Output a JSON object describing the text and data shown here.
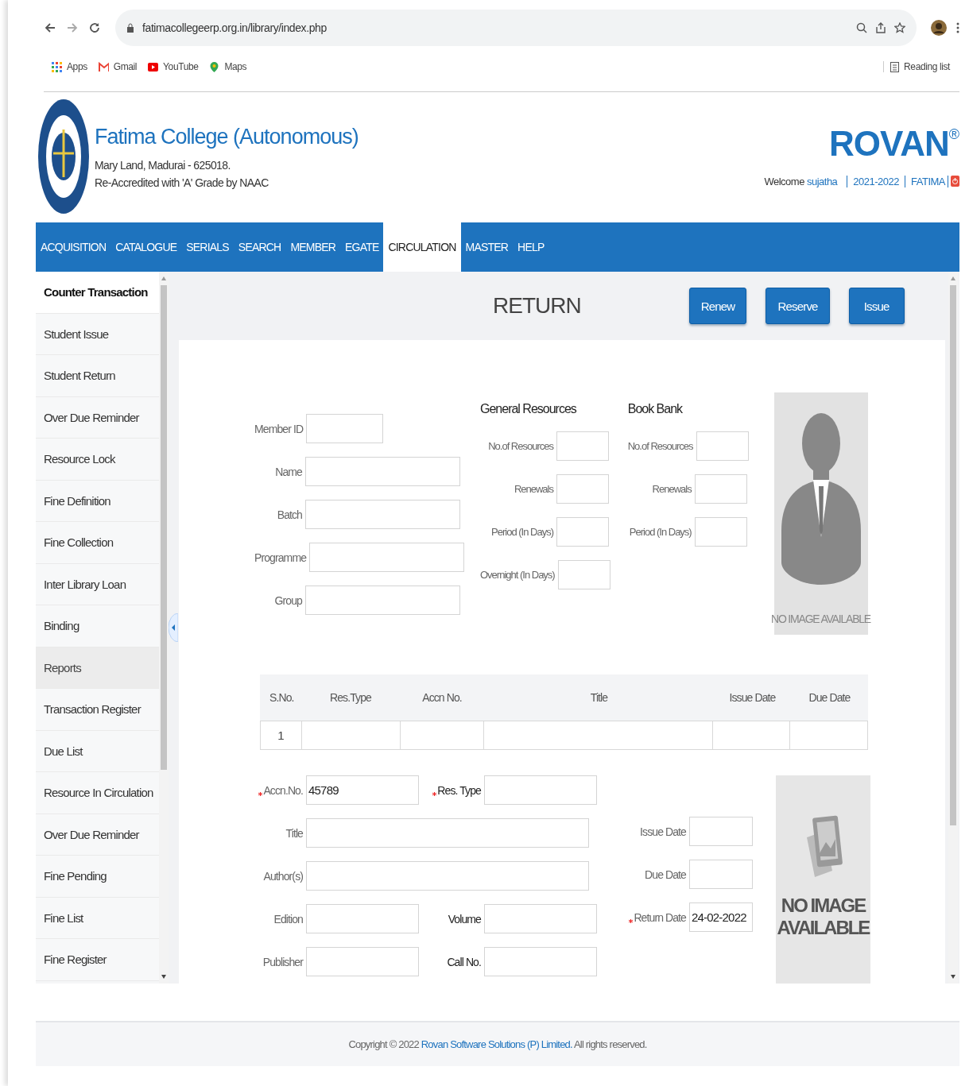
{
  "browser": {
    "url": "fatimacollegeerp.org.in/library/index.php",
    "bookmarks": [
      {
        "label": "Apps",
        "kind": "apps"
      },
      {
        "label": "Gmail",
        "kind": "gmail"
      },
      {
        "label": "YouTube",
        "kind": "youtube"
      },
      {
        "label": "Maps",
        "kind": "maps"
      }
    ],
    "reading_list": "Reading list"
  },
  "header": {
    "college": "Fatima College (Autonomous)",
    "address": "Mary Land, Madurai - 625018.",
    "accreditation": "Re-Accredited with 'A' Grade by NAAC",
    "brand": "ROVAN",
    "brand_mark": "®",
    "welcome": "Welcome",
    "user": "sujatha",
    "links": [
      "2021-2022",
      "FATIMA"
    ]
  },
  "nav": [
    {
      "label": "ACQUISITION",
      "selected": false
    },
    {
      "label": "CATALOGUE",
      "selected": false
    },
    {
      "label": "SERIALS",
      "selected": false
    },
    {
      "label": "SEARCH",
      "selected": false
    },
    {
      "label": "MEMBER",
      "selected": false
    },
    {
      "label": "EGATE",
      "selected": false
    },
    {
      "label": "CIRCULATION",
      "selected": true
    },
    {
      "label": "MASTER",
      "selected": false
    },
    {
      "label": "HELP",
      "selected": false
    }
  ],
  "sidebar": {
    "sections": [
      {
        "title": "Counter Transaction",
        "selected": true,
        "items": [
          "Student Issue",
          "Student Return",
          "Over Due Reminder",
          "Resource Lock",
          "Fine Definition",
          "Fine Collection",
          "Inter Library Loan",
          "Binding"
        ]
      },
      {
        "title": "Reports",
        "selected": false,
        "items": [
          "Transaction Register",
          "Due List",
          "Resource In Circulation",
          "Over Due Reminder",
          "Fine Pending",
          "Fine List",
          "Fine Register"
        ]
      }
    ]
  },
  "page": {
    "title": "RETURN",
    "actions": [
      "Renew",
      "Reserve",
      "Issue"
    ]
  },
  "member": {
    "fields": [
      {
        "label": "Member ID",
        "kind": "short"
      },
      {
        "label": "Name",
        "kind": "wide"
      },
      {
        "label": "Batch",
        "kind": "wide"
      },
      {
        "label": "Programme",
        "kind": "wide"
      },
      {
        "label": "Group",
        "kind": "wide"
      }
    ]
  },
  "general_resources": {
    "title": "General Resources",
    "fields": [
      "No.of Resources",
      "Renewals",
      "Period (In Days)",
      "Overnight (In Days)"
    ]
  },
  "book_bank": {
    "title": "Book Bank",
    "fields": [
      "No.of Resources",
      "Renewals",
      "Period (In Days)"
    ]
  },
  "member_photo": {
    "caption": "NO IMAGE AVAILABLE"
  },
  "issues_table": {
    "columns": [
      "S.No.",
      "Res.Type",
      "Accn No.",
      "Title",
      "Issue Date",
      "Due Date"
    ],
    "rows": [
      {
        "s_no": "1"
      }
    ]
  },
  "resource": {
    "rows": [
      [
        {
          "label": "Accn.No.",
          "value": "45789",
          "required": true
        },
        {
          "label": "Res. Type",
          "required": true
        }
      ],
      [
        {
          "label": "Title",
          "required": false
        }
      ],
      [
        {
          "label": "Author(s)",
          "required": false
        }
      ],
      [
        {
          "label": "Edition",
          "required": false
        },
        {
          "label": "Volume",
          "required": false
        }
      ],
      [
        {
          "label": "Publisher",
          "required": false
        },
        {
          "label": "Call No.",
          "required": false
        }
      ]
    ],
    "dates": [
      {
        "label": "Issue Date",
        "required": false
      },
      {
        "label": "Due Date",
        "required": false
      },
      {
        "label": "Return Date",
        "value": "24-02-2022",
        "required": true
      }
    ],
    "image_caption": "NO IMAGE AVAILABLE"
  },
  "footer": {
    "prefix": "Copyright © 2022",
    "company": "Rovan Software Solutions (P) Limited.",
    "suffix": "All rights reserved."
  }
}
